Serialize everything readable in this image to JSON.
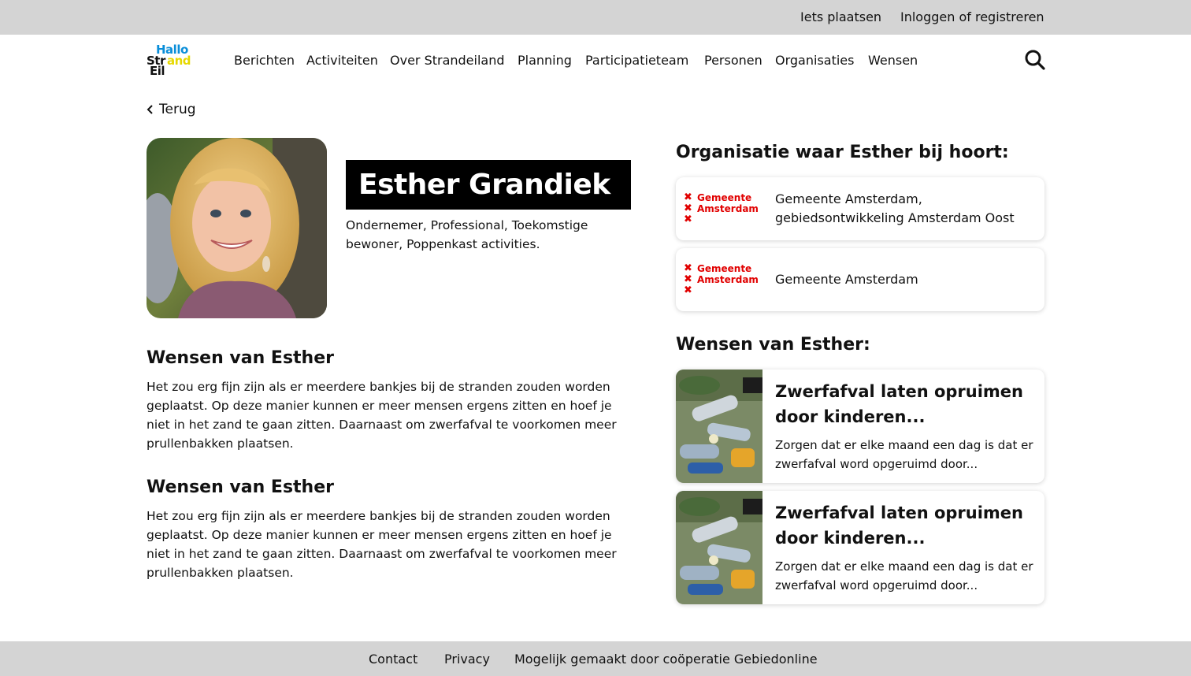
{
  "topbar": {
    "post_link": "Iets plaatsen",
    "login_link": "Inloggen of registreren"
  },
  "logo": {
    "line1": "Hallo",
    "line2a": "Str",
    "line2b": "and",
    "line3": "Eil",
    "colors": {
      "blue": "#0a8ed9",
      "yellow": "#f2e600",
      "black": "#111111"
    }
  },
  "nav": {
    "items": [
      "Berichten",
      "Activiteiten",
      "Over Strandeiland",
      "Planning",
      "Participatieteam",
      "Personen",
      "Organisaties",
      "Wensen"
    ]
  },
  "search": {
    "icon": "search-icon"
  },
  "back": {
    "label": "Terug",
    "icon": "chevron-left-icon"
  },
  "profile": {
    "name": "Esther Grandiek",
    "roles": "Ondernemer, Professional, Toekomstige bewoner, Poppenkast activities."
  },
  "wishes_main": [
    {
      "heading": "Wensen van Esther",
      "text": "Het zou erg fijn zijn als er meerdere bankjes bij de stranden zouden worden geplaatst. Op deze manier kunnen er meer mensen ergens zitten en hoef je niet in het zand te gaan zitten. Daarnaast om zwerfafval te voorkomen meer prullenbakken plaatsen."
    },
    {
      "heading": "Wensen van Esther",
      "text": "Het zou erg fijn zijn als er meerdere bankjes bij de stranden zouden worden geplaatst. Op deze manier kunnen er meer mensen ergens zitten en hoef je niet in het zand te gaan zitten. Daarnaast om zwerfafval te voorkomen meer prullenbakken plaatsen."
    }
  ],
  "organisations": {
    "heading": "Organisatie waar Esther bij hoort:",
    "items": [
      {
        "logo_line1": "Gemeente",
        "logo_line2": "Amsterdam",
        "name": "Gemeente Amsterdam, gebiedsontwikkeling Amsterdam Oost"
      },
      {
        "logo_line1": "Gemeente",
        "logo_line2": "Amsterdam",
        "name": "Gemeente Amsterdam"
      }
    ],
    "accent": "#e10000"
  },
  "wishes_side": {
    "heading": "Wensen van Esther:",
    "items": [
      {
        "title": "Zwerfafval laten opruimen door kinderen...",
        "desc": "Zorgen dat er elke maand een dag is dat er zwerfafval word opgeruimd door..."
      },
      {
        "title": "Zwerfafval laten opruimen door kinderen...",
        "desc": "Zorgen dat er elke maand een dag is dat er zwerfafval word opgeruimd door..."
      }
    ]
  },
  "footer": {
    "contact": "Contact",
    "privacy": "Privacy",
    "credit": "Mogelijk gemaakt door coöperatie Gebiedonline"
  }
}
